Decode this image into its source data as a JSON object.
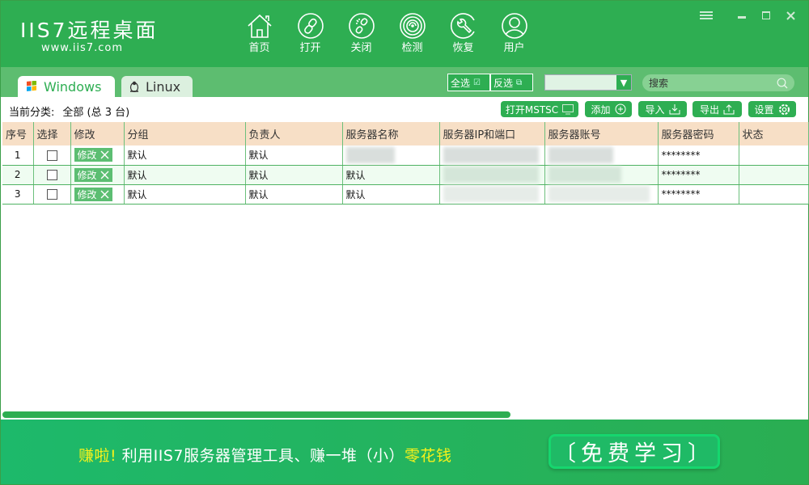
{
  "app": {
    "logo_title": "IIS7远程桌面",
    "logo_subtitle": "www.iis7.com"
  },
  "nav": [
    {
      "label": "首页",
      "icon": "home-icon"
    },
    {
      "label": "打开",
      "icon": "link-icon"
    },
    {
      "label": "关闭",
      "icon": "broken-link-icon"
    },
    {
      "label": "检测",
      "icon": "radar-icon"
    },
    {
      "label": "恢复",
      "icon": "wrench-icon"
    },
    {
      "label": "用户",
      "icon": "user-icon"
    }
  ],
  "tabs": [
    {
      "label": "Windows",
      "active": true
    },
    {
      "label": "Linux",
      "active": false
    }
  ],
  "selection": {
    "select_all": "全选",
    "invert": "反选"
  },
  "combo": {
    "value": ""
  },
  "search": {
    "placeholder": "搜索"
  },
  "crumb": {
    "label": "当前分类:",
    "value": "全部 (总 3 台)"
  },
  "toolbar": {
    "mstsc": "打开MSTSC",
    "add": "添加",
    "import": "导入",
    "export": "导出",
    "settings": "设置"
  },
  "table": {
    "columns": [
      "序号",
      "选择",
      "修改",
      "分组",
      "负责人",
      "服务器名称",
      "服务器IP和端口",
      "服务器账号",
      "服务器密码",
      "状态"
    ],
    "edit_label": "修改",
    "rows": [
      {
        "index": "1",
        "group": "默认",
        "owner": "默认",
        "name": "",
        "ip": "",
        "account": "",
        "password": "********",
        "status": ""
      },
      {
        "index": "2",
        "group": "默认",
        "owner": "默认",
        "name": "默认",
        "ip": "",
        "account": "",
        "password": "********",
        "status": ""
      },
      {
        "index": "3",
        "group": "默认",
        "owner": "默认",
        "name": "默认",
        "ip": "",
        "account": "",
        "password": "********",
        "status": ""
      }
    ]
  },
  "banner": {
    "prefix": "赚啦!",
    "middle": " 利用IIS7服务器管理工具、赚一堆（小）",
    "suffix": "零花钱",
    "button": "〔免费学习〕"
  },
  "colors": {
    "brand": "#2eae52",
    "tabbar": "#5dbd70",
    "header_row": "#f7dfc6",
    "highlight": "#f8f21a"
  }
}
